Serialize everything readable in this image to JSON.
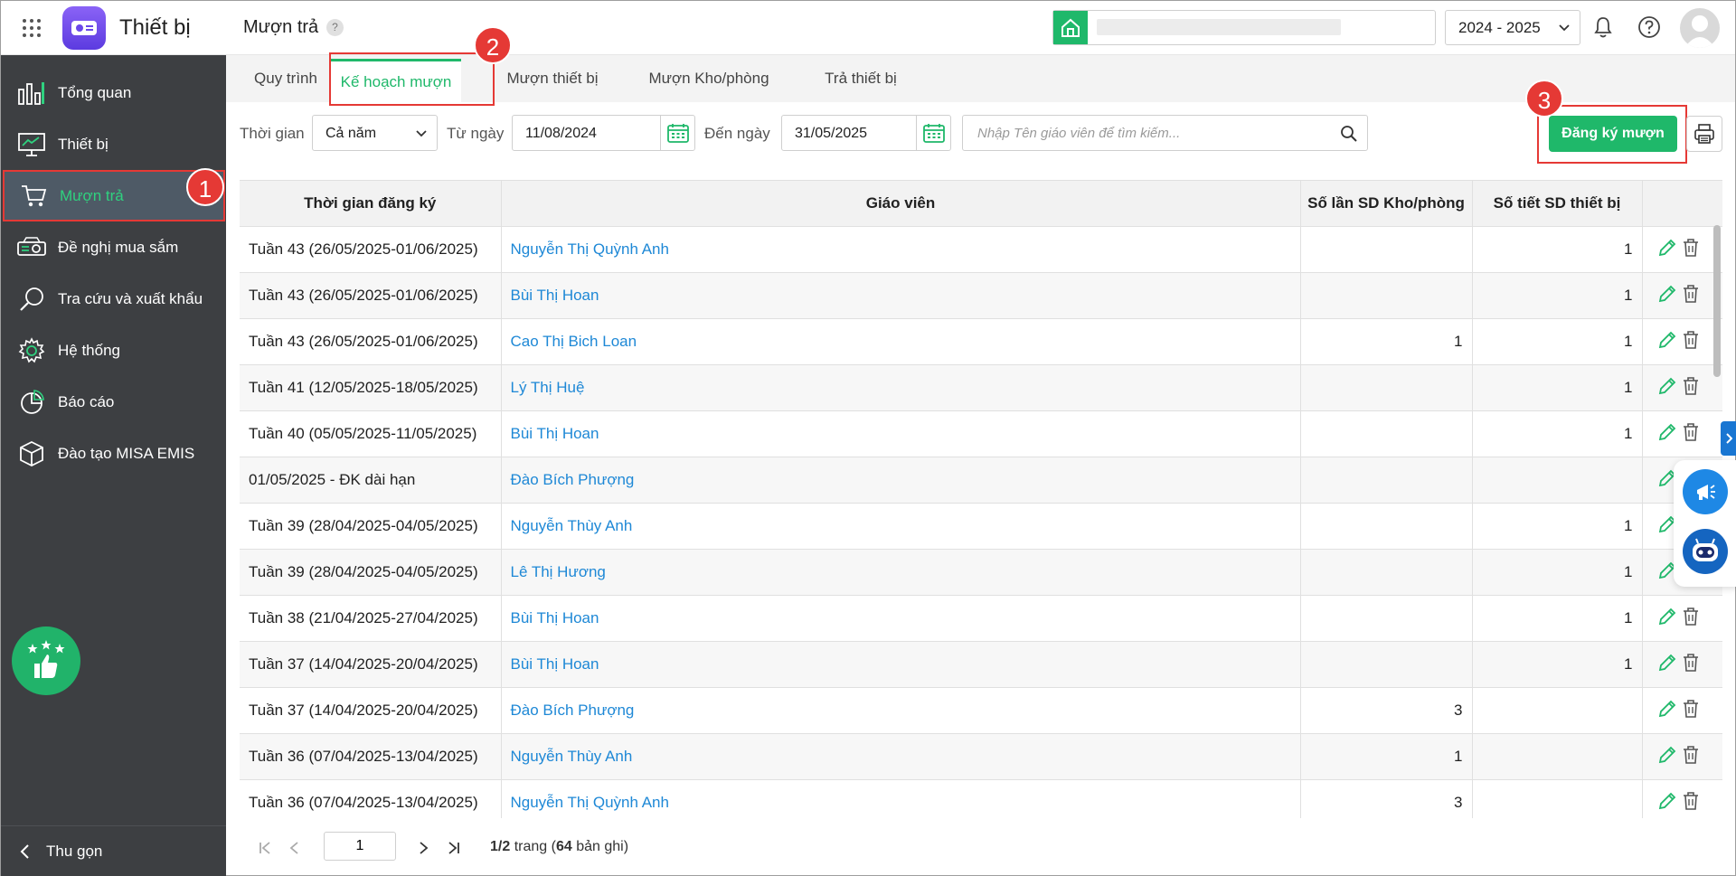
{
  "app": {
    "name": "Thiết bị",
    "page_title": "Mượn trả",
    "help": "?"
  },
  "header": {
    "year": "2024 - 2025"
  },
  "sidebar": {
    "items": [
      {
        "label": "Tổng quan",
        "icon": "bar-chart-icon"
      },
      {
        "label": "Thiết bị",
        "icon": "monitor-icon"
      },
      {
        "label": "Mượn trả",
        "icon": "cart-icon",
        "active": true
      },
      {
        "label": "Đề nghị mua sắm",
        "icon": "projector-icon"
      },
      {
        "label": "Tra cứu và xuất khẩu",
        "icon": "search-icon"
      },
      {
        "label": "Hệ thống",
        "icon": "gear-icon"
      },
      {
        "label": "Báo cáo",
        "icon": "pie-chart-icon"
      },
      {
        "label": "Đào tạo MISA EMIS",
        "icon": "cube-icon"
      }
    ],
    "collapse_label": "Thu gọn"
  },
  "tabs": [
    {
      "label": "Quy trình"
    },
    {
      "label": "Kế hoạch mượn",
      "active": true
    },
    {
      "label": "Mượn thiết bị"
    },
    {
      "label": "Mượn Kho/phòng"
    },
    {
      "label": "Trả thiết bị"
    }
  ],
  "badges": [
    "1",
    "2",
    "3"
  ],
  "filters": {
    "time_label": "Thời gian",
    "time_value": "Cả năm",
    "from_label": "Từ ngày",
    "from_value": "11/08/2024",
    "to_label": "Đến ngày",
    "to_value": "31/05/2025",
    "search_placeholder": "Nhập Tên giáo viên để tìm kiếm...",
    "register_button": "Đăng ký mượn"
  },
  "table": {
    "columns": [
      "Thời gian đăng ký",
      "Giáo viên",
      "Số lần SD Kho/phòng",
      "Số tiết SD thiết bị"
    ],
    "rows": [
      [
        "Tuần 43 (26/05/2025-01/06/2025)",
        "Nguyễn Thị Quỳnh Anh",
        "",
        "1"
      ],
      [
        "Tuần 43 (26/05/2025-01/06/2025)",
        "Bùi Thị Hoan",
        "",
        "1"
      ],
      [
        "Tuần 43 (26/05/2025-01/06/2025)",
        "Cao Thị Bich Loan",
        "1",
        "1"
      ],
      [
        "Tuần 41 (12/05/2025-18/05/2025)",
        "Lý Thị Huệ",
        "",
        "1"
      ],
      [
        "Tuần 40 (05/05/2025-11/05/2025)",
        "Bùi Thị Hoan",
        "",
        "1"
      ],
      [
        "01/05/2025 - ĐK dài hạn",
        "Đào Bích Phượng",
        "",
        ""
      ],
      [
        "Tuần 39 (28/04/2025-04/05/2025)",
        "Nguyễn Thùy Anh",
        "",
        "1"
      ],
      [
        "Tuần 39 (28/04/2025-04/05/2025)",
        "Lê Thị Hương",
        "",
        "1"
      ],
      [
        "Tuần 38 (21/04/2025-27/04/2025)",
        "Bùi Thị Hoan",
        "",
        "1"
      ],
      [
        "Tuần 37 (14/04/2025-20/04/2025)",
        "Bùi Thị Hoan",
        "",
        "1"
      ],
      [
        "Tuần 37 (14/04/2025-20/04/2025)",
        "Đào Bích Phượng",
        "3",
        ""
      ],
      [
        "Tuần 36 (07/04/2025-13/04/2025)",
        "Nguyễn Thùy Anh",
        "1",
        ""
      ],
      [
        "Tuần 36 (07/04/2025-13/04/2025)",
        "Nguyễn Thị Quỳnh Anh",
        "3",
        ""
      ]
    ]
  },
  "pager": {
    "page": "1",
    "current": "1/2",
    "page_word": "trang",
    "total": "64",
    "records_word": "bản ghi"
  },
  "colors": {
    "accent": "#1fb86a",
    "sidebar": "#3d3f42",
    "link": "#1e88d6",
    "highlight": "#e53935"
  }
}
